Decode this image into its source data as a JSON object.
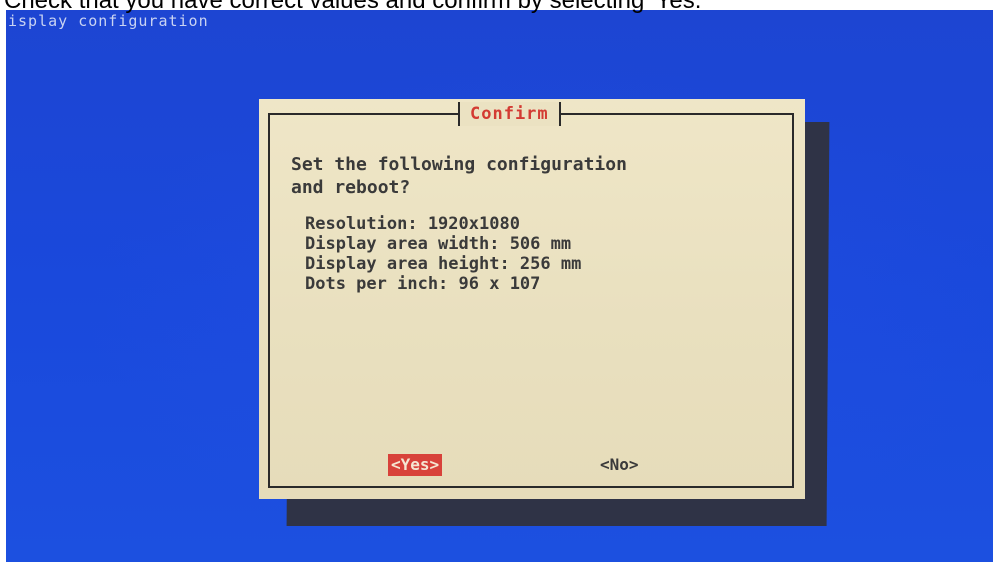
{
  "caption": "Check that you have correct values and confirm by selecting 'Yes.'",
  "screen": {
    "backtitle": "isplay configuration",
    "dialog": {
      "title": "Confirm",
      "message_line1": "Set the following configuration",
      "message_line2": "and reboot?",
      "details": [
        "Resolution: 1920x1080",
        "Display area width: 506 mm",
        "Display area height: 256 mm",
        "Dots per inch: 96 x 107"
      ],
      "buttons": {
        "yes_label": "<Yes>",
        "no_label": "<No>",
        "selected": "yes"
      }
    }
  },
  "colors": {
    "screen_blue": "#1a49dc",
    "dialog_bg": "#ebe2c2",
    "title_red": "#d33b33",
    "selected_button_bg": "#d8423a",
    "text_dark": "#3a3a3a"
  }
}
